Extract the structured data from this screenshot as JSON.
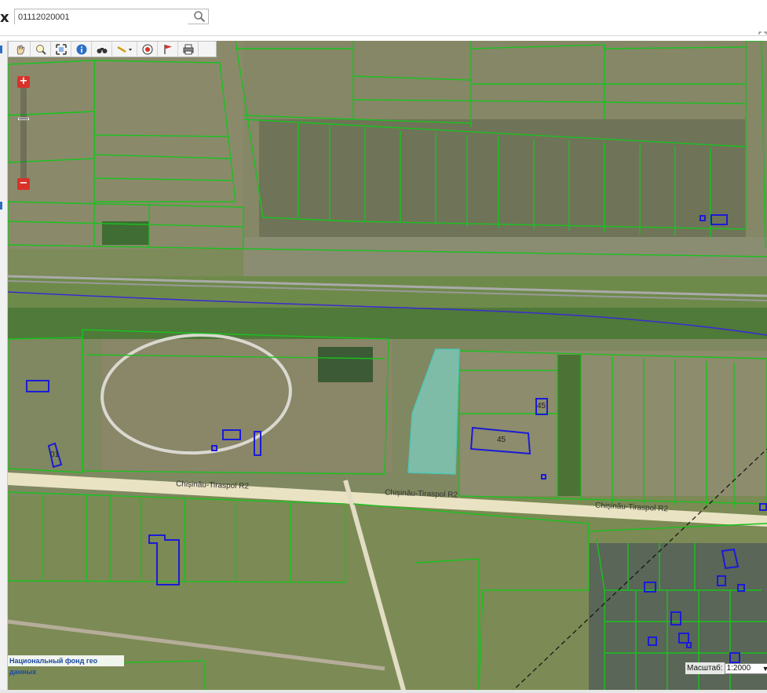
{
  "header": {
    "brand_glyph": "x",
    "search": {
      "value": "01112020001",
      "placeholder": ""
    }
  },
  "toolbar": {
    "tools": [
      "pan-hand-icon",
      "zoom-extent-icon",
      "full-extent-icon",
      "info-icon",
      "binoculars-icon",
      "measure-dropdown-icon",
      "target-icon",
      "flag-icon",
      "print-icon"
    ]
  },
  "zoom": {
    "plus": "+",
    "minus": "−"
  },
  "map": {
    "road_labels": [
      "Chișinău-Tiraspol R2",
      "Chișinău-Tiraspol R2",
      "Chișinău-Tiraspol R2"
    ],
    "parcel_labels": [
      "45",
      "45",
      "01"
    ],
    "colors": {
      "parcel_outline": "#19c21f",
      "building_outline": "#1b1bd6",
      "selected_fill": "#7fe0d8",
      "river": "#3a2bd0"
    }
  },
  "footer": {
    "credit": "Национальный фонд гео данных",
    "scale_label": "Масштаб:",
    "scale_value": "1:2000"
  }
}
